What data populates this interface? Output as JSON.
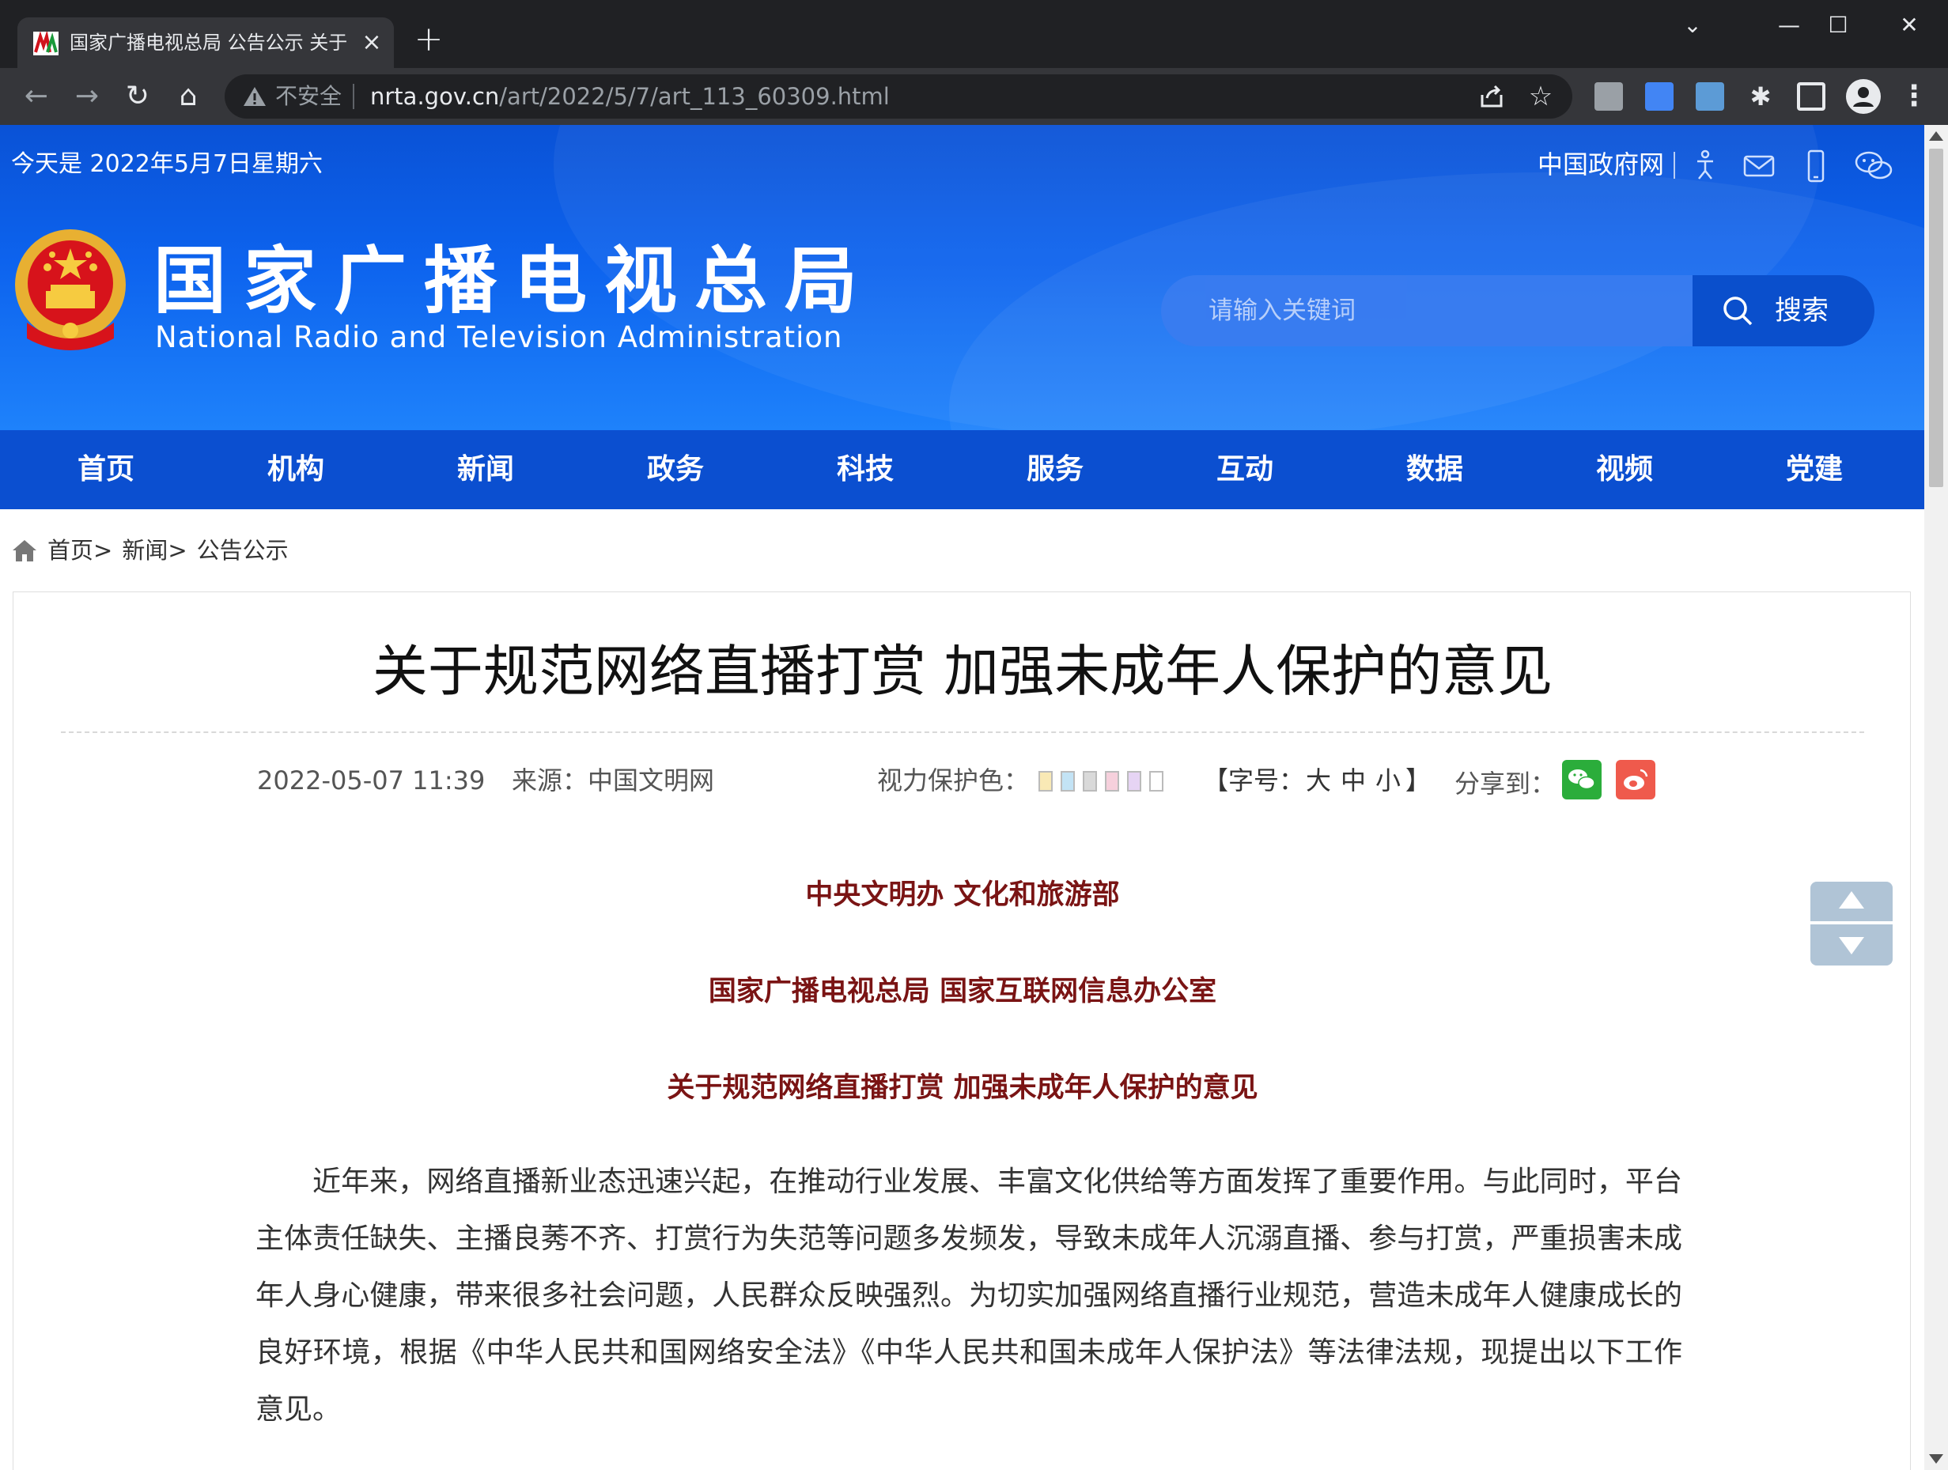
{
  "browser": {
    "tab_title": "国家广播电视总局 公告公示 关于",
    "tab_close": "×",
    "new_tab": "+",
    "window_controls": {
      "chevron": "⌄",
      "minimize": "—",
      "maximize": "☐",
      "close": "✕"
    },
    "nav_icons": {
      "back": "←",
      "forward": "→",
      "reload": "↻",
      "home": "⌂"
    },
    "security_label": "不安全",
    "url_domain": "nrta.gov.cn",
    "url_path": "/art/2022/5/7/art_113_60309.html",
    "star": "☆",
    "puzzle": "✱",
    "menu": "⋮"
  },
  "header": {
    "date": "今天是 2022年5月7日星期六",
    "gov_link": "中国政府网",
    "site_title_cn": "国家广播电视总局",
    "site_title_en": "National Radio and Television Administration",
    "search": {
      "placeholder": "请输入关键词",
      "button_label": "搜索"
    },
    "colors": {
      "header_blue": "#0d63ee",
      "nav_blue": "#0b4fd0"
    }
  },
  "nav": {
    "items": [
      {
        "label": "首页"
      },
      {
        "label": "机构"
      },
      {
        "label": "新闻"
      },
      {
        "label": "政务"
      },
      {
        "label": "科技"
      },
      {
        "label": "服务"
      },
      {
        "label": "互动"
      },
      {
        "label": "数据"
      },
      {
        "label": "视频"
      },
      {
        "label": "党建"
      }
    ]
  },
  "breadcrumb": [
    {
      "label": "首页>"
    },
    {
      "label": "新闻>"
    },
    {
      "label": "公告公示"
    }
  ],
  "article": {
    "title": "关于规范网络直播打赏 加强未成年人保护的意见",
    "date": "2022-05-07 11:39",
    "source": "来源：中国文明网",
    "eye_protection_label": "视力保护色：",
    "eye_colors": [
      "#f9e9b5",
      "#c3e3f5",
      "#d9d9d9",
      "#f6d0dc",
      "#e6d4f4",
      "#ffffff"
    ],
    "font_size": {
      "bracket_left": "【字号：",
      "large": "大",
      "medium": "中",
      "small": "小",
      "bracket_right": "】"
    },
    "share_label": "分享到：",
    "issuers": [
      "中央文明办 文化和旅游部",
      "国家广播电视总局 国家互联网信息办公室"
    ],
    "subtitle": "关于规范网络直播打赏 加强未成年人保护的意见",
    "issuer_color": "#7a1414",
    "body": "近年来，网络直播新业态迅速兴起，在推动行业发展、丰富文化供给等方面发挥了重要作用。与此同时，平台主体责任缺失、主播良莠不齐、打赏行为失范等问题多发频发，导致未成年人沉溺直播、参与打赏，严重损害未成年人身心健康，带来很多社会问题，人民群众反映强烈。为切实加强网络直播行业规范，营造未成年人健康成长的良好环境，根据《中华人民共和国网络安全法》《中华人民共和国未成年人保护法》等法律法规，现提出以下工作意见。"
  }
}
